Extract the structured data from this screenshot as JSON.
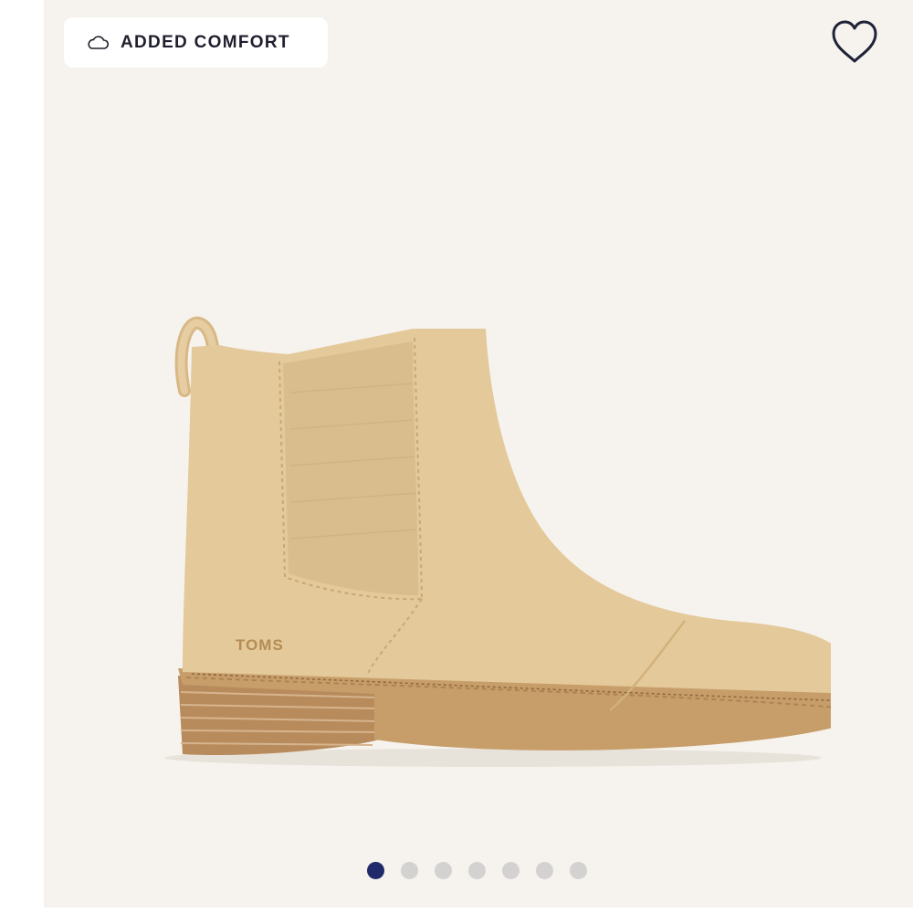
{
  "badge": {
    "icon": "cloud-icon",
    "label": "ADDED COMFORT"
  },
  "favorite": {
    "icon": "heart-icon"
  },
  "product_image": {
    "logo_text": "TOMS"
  },
  "carousel": {
    "total": 7,
    "active_index": 0
  },
  "colors": {
    "background": "#f6f3ee",
    "active_dot": "#1f2a6b",
    "inactive_dot": "#d3d2d0",
    "boot": "#e4c99a",
    "sole": "#c49b6a"
  }
}
